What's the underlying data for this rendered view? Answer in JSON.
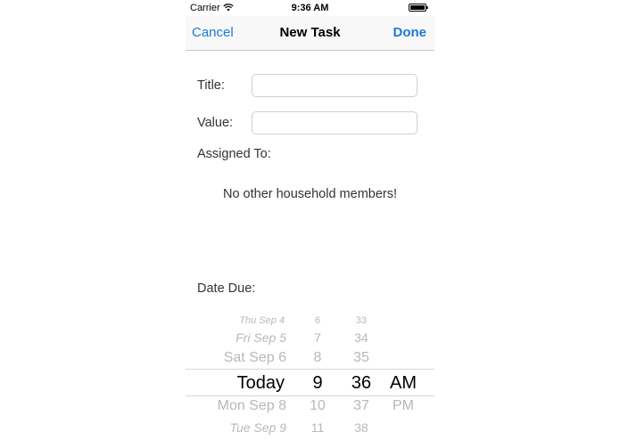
{
  "status_bar": {
    "carrier": "Carrier",
    "time": "9:36 AM"
  },
  "nav": {
    "cancel_label": "Cancel",
    "title": "New Task",
    "done_label": "Done"
  },
  "form": {
    "title_label": "Title:",
    "title_value": "",
    "value_label": "Value:",
    "value_value": "",
    "assigned_label": "Assigned To:",
    "empty_message": "No other household members!",
    "date_due_label": "Date Due:"
  },
  "date_picker": {
    "days": [
      "Thu Sep 4",
      "Fri Sep 5",
      "Sat Sep 6",
      "Today",
      "Mon Sep 8",
      "Tue Sep 9"
    ],
    "hours": [
      "6",
      "7",
      "8",
      "9",
      "10",
      "11"
    ],
    "minutes": [
      "33",
      "34",
      "35",
      "36",
      "37",
      "38"
    ],
    "periods": [
      "AM",
      "PM"
    ],
    "selected": {
      "day": "Today",
      "hour": "9",
      "minute": "36",
      "period": "AM"
    }
  },
  "colors": {
    "accent": "#1c7ad6",
    "separator": "#c8c8cc",
    "picker_inactive": "#b8b8b8"
  }
}
